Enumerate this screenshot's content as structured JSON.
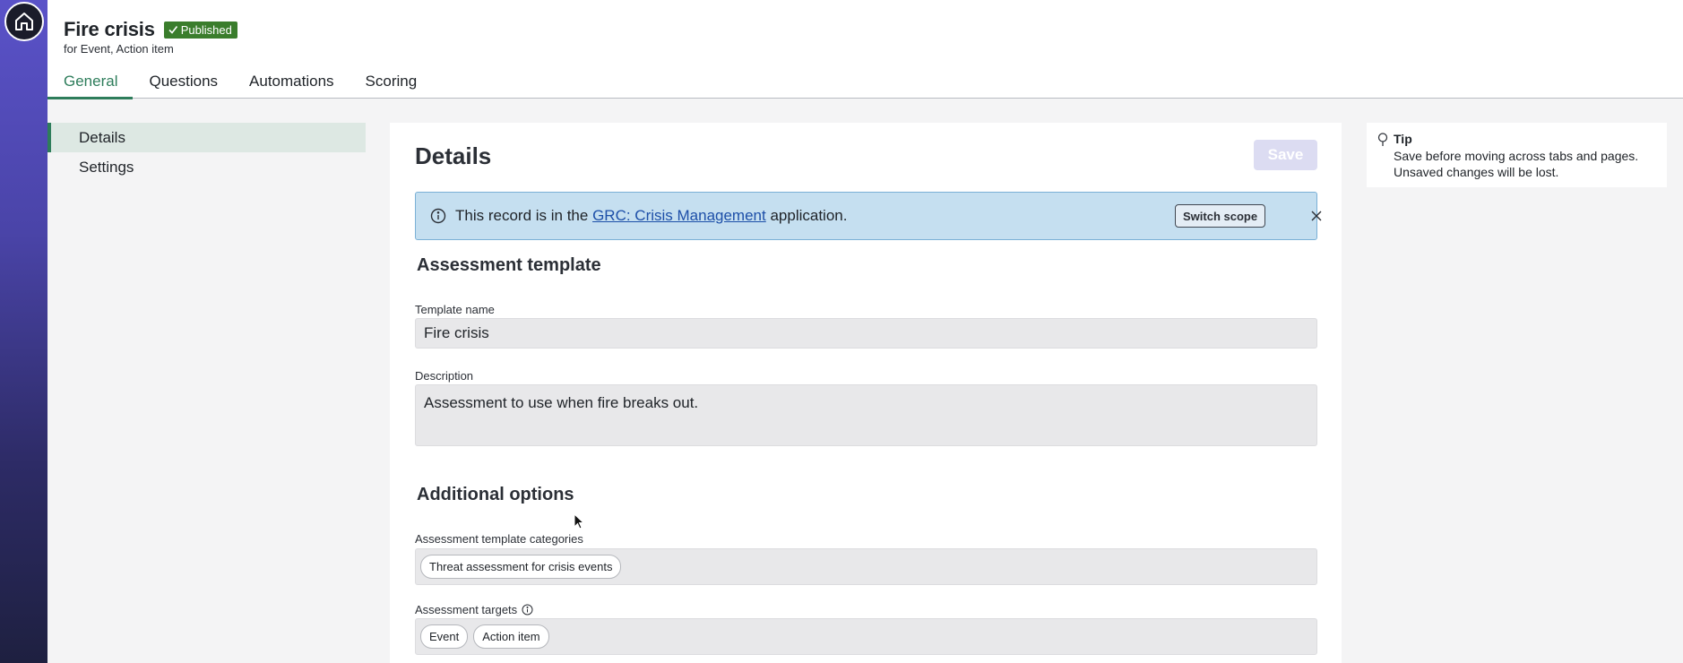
{
  "record": {
    "title": "Fire crisis",
    "status": "Published",
    "subtitle": "for Event, Action item"
  },
  "tabs": [
    {
      "label": "General",
      "active": true
    },
    {
      "label": "Questions",
      "active": false
    },
    {
      "label": "Automations",
      "active": false
    },
    {
      "label": "Scoring",
      "active": false
    }
  ],
  "leftnav": [
    {
      "label": "Details",
      "active": true
    },
    {
      "label": "Settings",
      "active": false
    }
  ],
  "main": {
    "title": "Details",
    "save_label": "Save",
    "banner": {
      "prefix": "This record is in the ",
      "link": "GRC: Crisis Management",
      "suffix": " application.",
      "switch_label": "Switch scope"
    },
    "section1": {
      "title": "Assessment template",
      "template_name_label": "Template name",
      "template_name_value": "Fire crisis",
      "description_label": "Description",
      "description_value": "Assessment to use when fire breaks out."
    },
    "section2": {
      "title": "Additional options",
      "categories_label": "Assessment template categories",
      "categories": [
        "Threat assessment for crisis events"
      ],
      "targets_label": "Assessment targets",
      "targets": [
        "Event",
        "Action item"
      ]
    }
  },
  "tip": {
    "title": "Tip",
    "text": "Save before moving across tabs and pages. Unsaved changes will be lost."
  },
  "colors": {
    "accent": "#2e7d5b",
    "published_badge": "#3a7d2c",
    "banner_bg": "#c5dff0",
    "link": "#1d4fa8",
    "rail_top": "#5a52c8",
    "rail_bottom": "#1e2040"
  }
}
